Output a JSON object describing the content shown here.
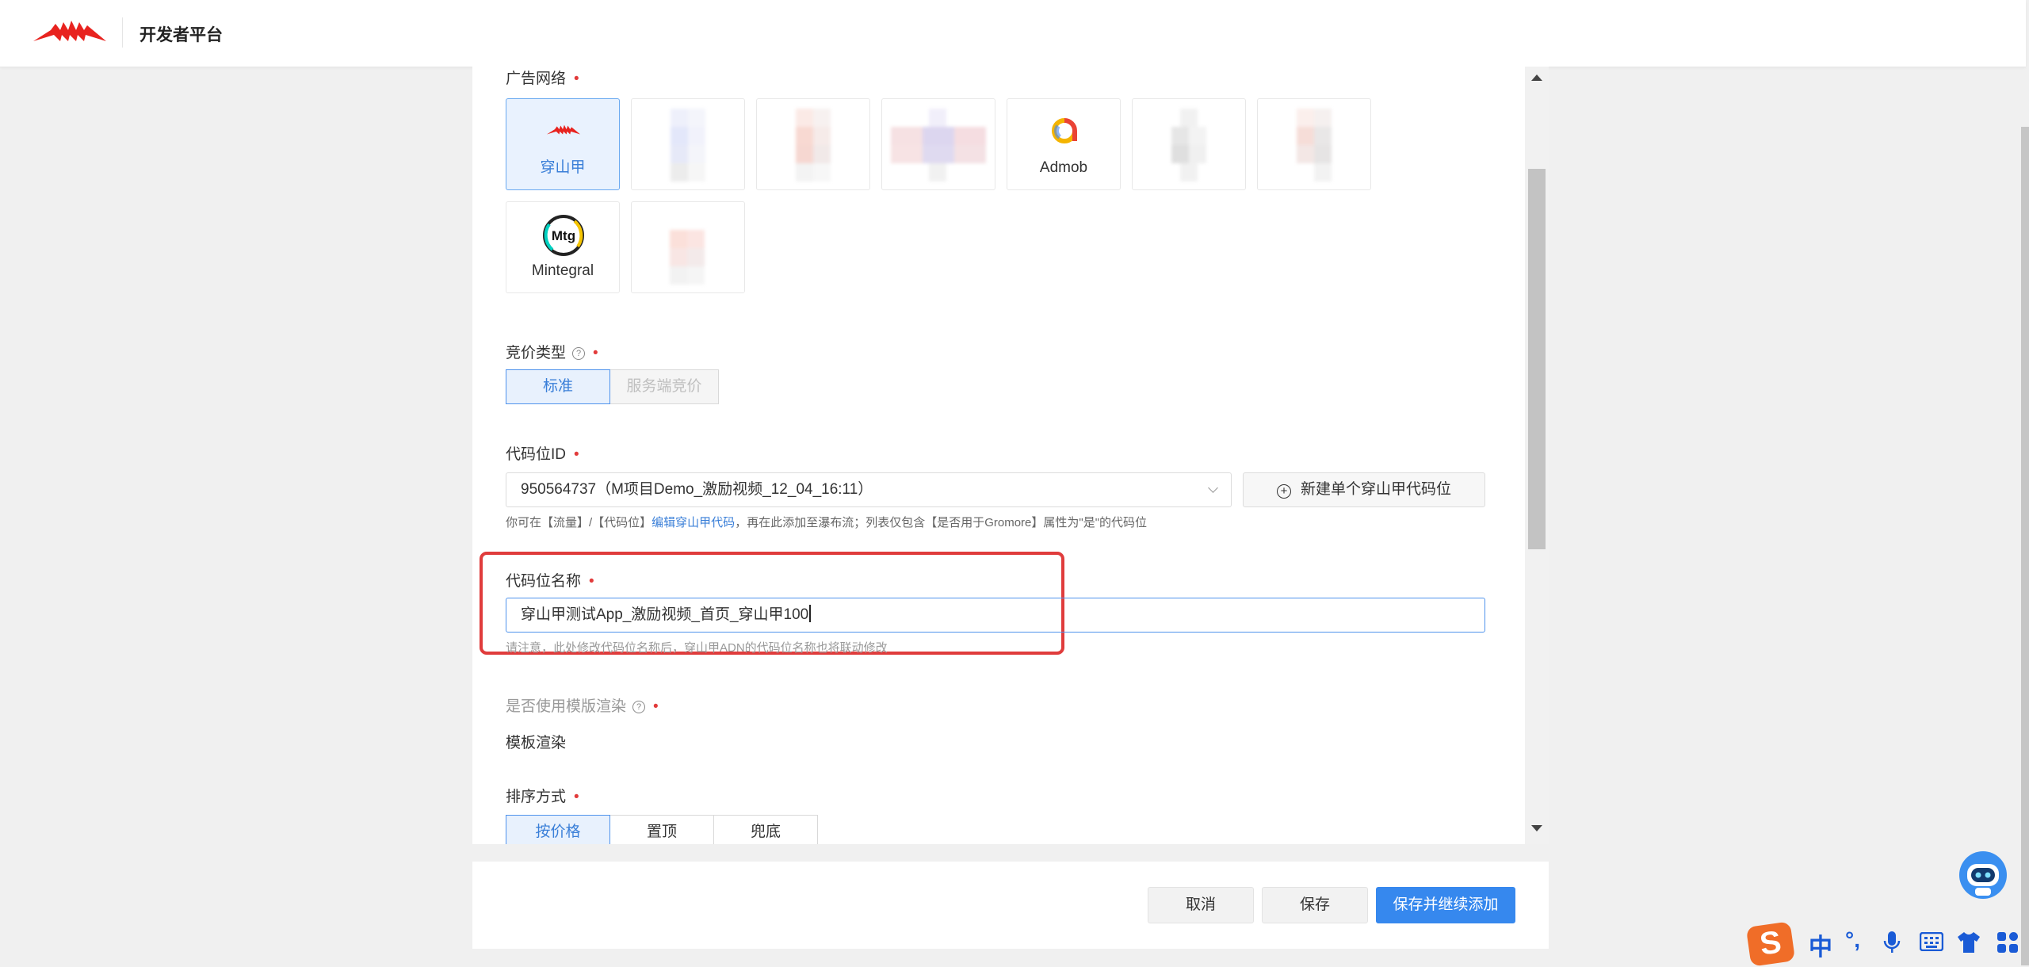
{
  "header": {
    "brand": "开发者平台",
    "logo_icon": "pangolin-logo-icon"
  },
  "form": {
    "ad_network": {
      "label": "广告网络",
      "required": "•",
      "cards": [
        {
          "name": "穿山甲",
          "icon": "pangolin-icon",
          "selected": true
        },
        {
          "name": "",
          "icon": "blurred-network-icon",
          "selected": false
        },
        {
          "name": "",
          "icon": "blurred-network-icon",
          "selected": false
        },
        {
          "name": "",
          "icon": "blurred-network-icon",
          "selected": false
        },
        {
          "name": "Admob",
          "icon": "admob-icon",
          "selected": false
        },
        {
          "name": "",
          "icon": "blurred-network-icon",
          "selected": false
        },
        {
          "name": "",
          "icon": "blurred-network-icon",
          "selected": false
        },
        {
          "name": "Mintegral",
          "icon": "mintegral-icon",
          "selected": false
        },
        {
          "name": "",
          "icon": "blurred-network-icon",
          "selected": false
        }
      ]
    },
    "bid_type": {
      "label": "竞价类型",
      "required": "•",
      "options": [
        "标准",
        "服务端竞价"
      ],
      "selected": "标准"
    },
    "slot_id": {
      "label": "代码位ID",
      "required": "•",
      "value": "950564737（M项目Demo_激励视频_12_04_16:11）",
      "new_button": "新建单个穿山甲代码位",
      "hint_prefix": "你可在【流量】/【代码位】",
      "hint_link": "编辑穿山甲代码",
      "hint_suffix": "，再在此添加至瀑布流；列表仅包含【是否用于Gromore】属性为\"是\"的代码位"
    },
    "slot_name": {
      "label": "代码位名称",
      "required": "•",
      "value": "穿山甲测试App_激励视频_首页_穿山甲100",
      "hint": "请注意，此处修改代码位名称后，穿山甲ADN的代码位名称也将联动修改"
    },
    "template": {
      "label": "是否使用模版渲染",
      "required": "•",
      "value": "模板渲染"
    },
    "sort": {
      "label": "排序方式",
      "required": "•",
      "options": [
        "按价格",
        "置顶",
        "兜底"
      ],
      "selected": "按价格"
    }
  },
  "footer": {
    "cancel": "取消",
    "save": "保存",
    "save_continue": "保存并继续添加"
  },
  "ime": {
    "logo": "S",
    "lang": "中",
    "punct": "°,"
  },
  "colors": {
    "accent": "#3688ee",
    "required": "#e23b3b",
    "highlight": "#e03c3c",
    "brand_red": "#e8231f"
  }
}
